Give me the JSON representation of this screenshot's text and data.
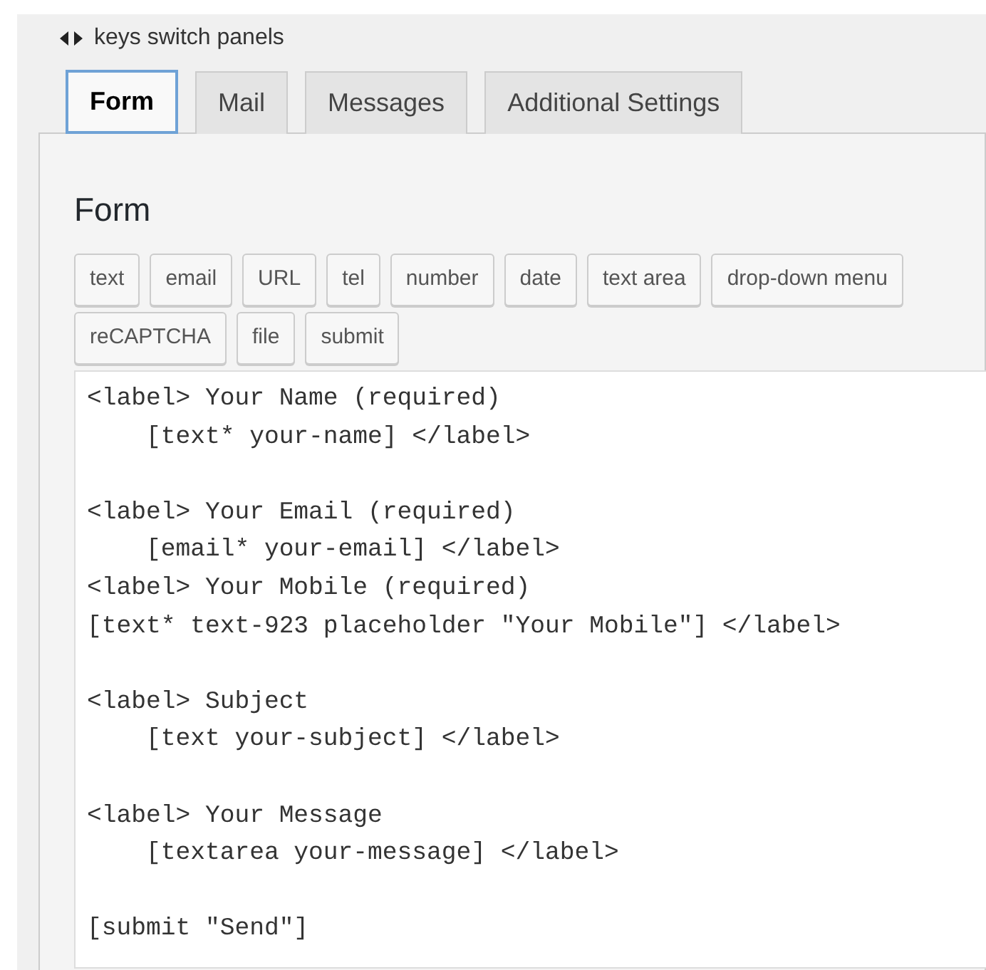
{
  "hint": {
    "text": "keys switch panels"
  },
  "tabs": [
    {
      "label": "Form",
      "selected": true
    },
    {
      "label": "Mail",
      "selected": false
    },
    {
      "label": "Messages",
      "selected": false
    },
    {
      "label": "Additional Settings",
      "selected": false
    }
  ],
  "panel": {
    "title": "Form",
    "tag_buttons": [
      [
        "text",
        "email",
        "URL",
        "tel",
        "number",
        "date",
        "text area",
        "drop-down menu"
      ],
      [
        "reCAPTCHA",
        "file",
        "submit"
      ]
    ],
    "code": "<label> Your Name (required)\n    [text* your-name] </label>\n\n<label> Your Email (required)\n    [email* your-email] </label>\n<label> Your Mobile (required)\n[text* text-923 placeholder \"Your Mobile\"] </label>\n\n<label> Subject\n    [text your-subject] </label>\n\n<label> Your Message\n    [textarea your-message] </label>\n\n[submit \"Send\"]"
  }
}
